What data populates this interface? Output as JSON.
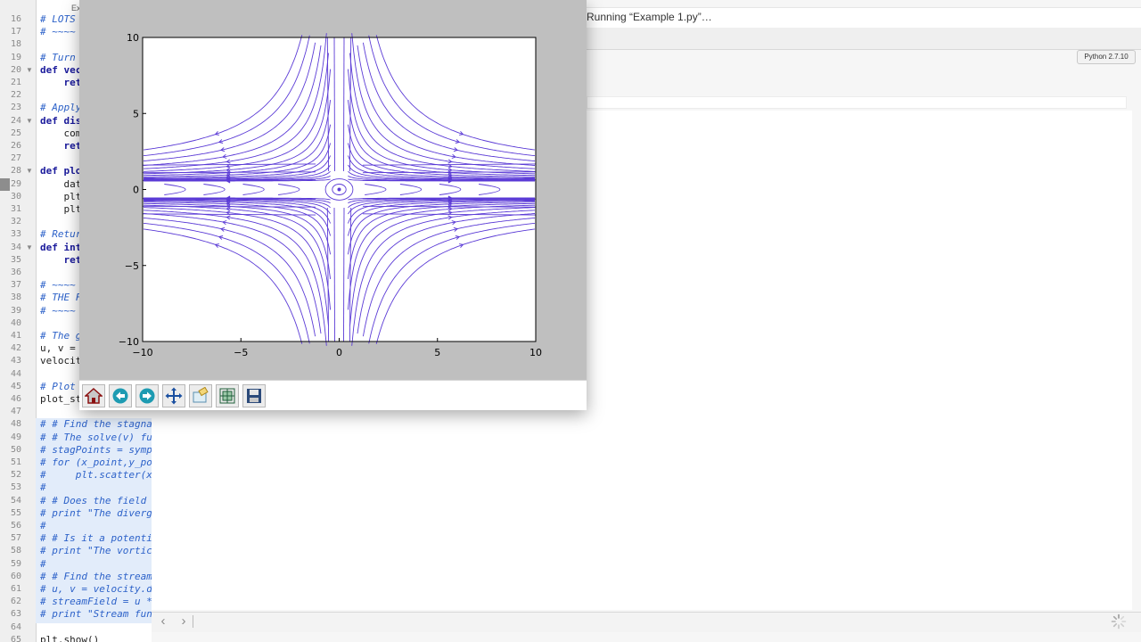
{
  "editor": {
    "tab_title": "Ex",
    "line_numbers": [
      "16",
      "17",
      "18",
      "19",
      "20",
      "21",
      "22",
      "23",
      "24",
      "25",
      "26",
      "27",
      "28",
      "29",
      "30",
      "31",
      "32",
      "33",
      "34",
      "35",
      "36",
      "37",
      "38",
      "39",
      "40",
      "41",
      "42",
      "43",
      "44",
      "45",
      "46",
      "47",
      "48",
      "49",
      "50",
      "51",
      "52",
      "53",
      "54",
      "55",
      "56",
      "57",
      "58",
      "59",
      "60",
      "61",
      "62",
      "63",
      "64",
      "65"
    ],
    "lines": [
      {
        "text": "# LOTS",
        "kind": "comment"
      },
      {
        "text": "# ~~~~",
        "kind": "comment"
      },
      {
        "text": "",
        "kind": "plain"
      },
      {
        "text": "# Turn",
        "kind": "comment"
      },
      {
        "text": "def vec",
        "kind": "def"
      },
      {
        "text": "    ret",
        "kind": "kw"
      },
      {
        "text": "",
        "kind": "plain"
      },
      {
        "text": "# Apply",
        "kind": "comment"
      },
      {
        "text": "def dis",
        "kind": "def"
      },
      {
        "text": "    com",
        "kind": "plain"
      },
      {
        "text": "    ret",
        "kind": "kw"
      },
      {
        "text": "",
        "kind": "plain"
      },
      {
        "text": "def plo",
        "kind": "def"
      },
      {
        "text": "    dat",
        "kind": "plain"
      },
      {
        "text": "    plt",
        "kind": "plain"
      },
      {
        "text": "    plt",
        "kind": "plain"
      },
      {
        "text": "",
        "kind": "plain"
      },
      {
        "text": "# Retur",
        "kind": "comment"
      },
      {
        "text": "def int",
        "kind": "def"
      },
      {
        "text": "    ret",
        "kind": "kw"
      },
      {
        "text": "",
        "kind": "plain"
      },
      {
        "text": "# ~~~~",
        "kind": "comment"
      },
      {
        "text": "# THE F",
        "kind": "comment"
      },
      {
        "text": "# ~~~~",
        "kind": "comment"
      },
      {
        "text": "",
        "kind": "plain"
      },
      {
        "text": "# The g",
        "kind": "comment"
      },
      {
        "text": "u, v =",
        "kind": "plain"
      },
      {
        "text": "velocit",
        "kind": "plain"
      },
      {
        "text": "",
        "kind": "plain"
      },
      {
        "text": "# Plot",
        "kind": "comment"
      },
      {
        "text": "plot_st",
        "kind": "plain"
      },
      {
        "text": "",
        "kind": "plain"
      },
      {
        "text": "# # Find the stagnat",
        "kind": "comment"
      },
      {
        "text": "# # The solve(v) fun",
        "kind": "comment"
      },
      {
        "text": "# stagPoints = sympy",
        "kind": "comment"
      },
      {
        "text": "# for (x_point,y_poi",
        "kind": "comment"
      },
      {
        "text": "#     plt.scatter(x_",
        "kind": "comment"
      },
      {
        "text": "#",
        "kind": "comment"
      },
      {
        "text": "# # Does the field s",
        "kind": "comment"
      },
      {
        "text": "# print \"The diverge",
        "kind": "comment"
      },
      {
        "text": "#",
        "kind": "comment"
      },
      {
        "text": "# # Is it a potentia",
        "kind": "comment"
      },
      {
        "text": "# print \"The vortici",
        "kind": "comment"
      },
      {
        "text": "#",
        "kind": "comment"
      },
      {
        "text": "# # Find the stream",
        "kind": "comment"
      },
      {
        "text": "# u, v = velocity.do",
        "kind": "comment"
      },
      {
        "text": "# streamField = u *",
        "kind": "comment"
      },
      {
        "text": "# print \"Stream func",
        "kind": "comment"
      },
      {
        "text": "",
        "kind": "plain"
      },
      {
        "text": "plt.show()",
        "kind": "plain"
      }
    ]
  },
  "status": {
    "text": "Running “Example 1.py”…"
  },
  "python_version": "Python 2.7.10",
  "nav": {
    "back": "‹",
    "forward": "›"
  },
  "figure": {
    "toolbar": [
      {
        "name": "home-icon",
        "tip": "home"
      },
      {
        "name": "back-arrow-icon",
        "tip": "back"
      },
      {
        "name": "forward-arrow-icon",
        "tip": "forward"
      },
      {
        "name": "pan-icon",
        "tip": "pan"
      },
      {
        "name": "zoom-icon",
        "tip": "zoom"
      },
      {
        "name": "subplots-icon",
        "tip": "subplots"
      },
      {
        "name": "save-icon",
        "tip": "save"
      }
    ]
  },
  "chart_data": {
    "type": "streamplot",
    "title": "",
    "xlabel": "",
    "ylabel": "",
    "xlim": [
      -10,
      10
    ],
    "ylim": [
      -10,
      10
    ],
    "xticks": [
      "−10",
      "−5",
      "0",
      "5",
      "10"
    ],
    "yticks": [
      "−10",
      "−5",
      "0",
      "5",
      "10"
    ],
    "line_color": "#5b3bd6",
    "grid": false,
    "legend": "none"
  }
}
